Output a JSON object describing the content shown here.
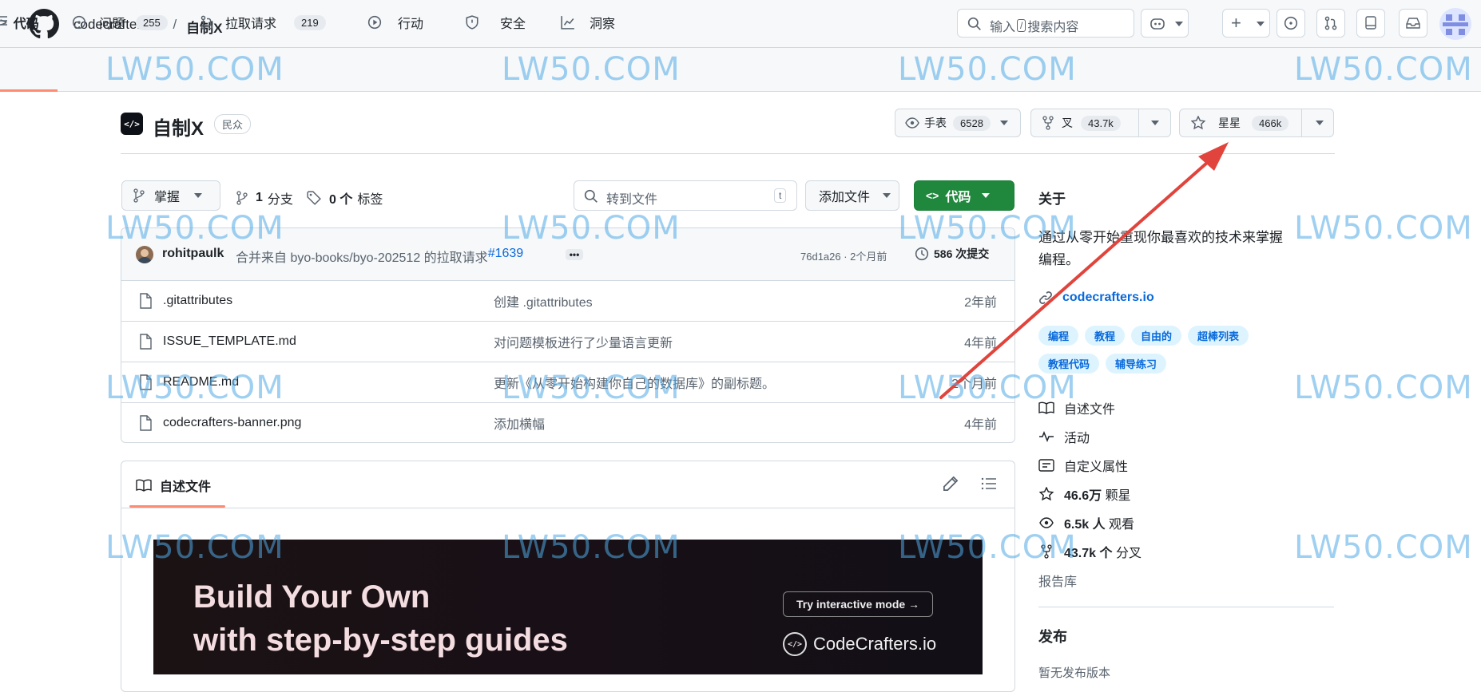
{
  "header": {
    "org": "codecrafters-io",
    "separator": "/",
    "repo": "自制X",
    "search_placeholder": "输入",
    "search_key": "/",
    "search_suffix": "搜索内容"
  },
  "tabs": [
    {
      "label": "代码"
    },
    {
      "label": "问题",
      "count": "255"
    },
    {
      "label": "拉取请求",
      "count": "219"
    },
    {
      "label": "行动"
    },
    {
      "label": "安全"
    },
    {
      "label": "洞察"
    }
  ],
  "repo_head": {
    "name": "自制X",
    "visibility": "民众",
    "watch_label": "手表",
    "watch_count": "6528",
    "fork_label": "叉",
    "fork_count": "43.7k",
    "star_label": "星星",
    "star_count": "466k"
  },
  "toolbar": {
    "branch": "掌握",
    "branches_num": "1",
    "branches_label": "分支",
    "tags_num": "0 个",
    "tags_label": "标签",
    "goto_file": "转到文件",
    "goto_key": "t",
    "add_file": "添加文件",
    "code": "代码"
  },
  "commit": {
    "author": "rohitpaulk",
    "message": "合并来自 byo-books/byo-202512 的拉取请求",
    "pr": "#1639",
    "hash": "76d1a26 · 2个月前",
    "count": "586 次提交"
  },
  "files": [
    {
      "name": ".gitattributes",
      "message": "创建 .gitattributes",
      "time": "2年前"
    },
    {
      "name": "ISSUE_TEMPLATE.md",
      "message": "对问题模板进行了少量语言更新",
      "time": "4年前"
    },
    {
      "name": "README.md",
      "message": "更新《从零开始构建你自己的数据库》的副标题。",
      "time": "2个月前"
    },
    {
      "name": "codecrafters-banner.png",
      "message": "添加横幅",
      "time": "4年前"
    }
  ],
  "readme": {
    "tab": "自述文件",
    "banner_line1": "Build Your Own",
    "banner_line2": "with step-by-step guides",
    "banner_button": "Try interactive mode →",
    "banner_brand": "CodeCrafters.io"
  },
  "about": {
    "title": "关于",
    "description_line1": "通过从零开始重现你最喜欢的技术来掌握",
    "description_line2": "编程。",
    "link": "codecrafters.io",
    "topics": [
      "编程",
      "教程",
      "自由的",
      "超棒列表",
      "教程代码",
      "辅导练习"
    ],
    "readme": "自述文件",
    "activity": "活动",
    "custom_props": "自定义属性",
    "stars_num": "46.6万",
    "stars_label": "颗星",
    "watchers_num": "6.5k 人",
    "watchers_label": "观看",
    "forks_num": "43.7k 个",
    "forks_label": "分叉",
    "report": "报告库"
  },
  "releases": {
    "title": "发布",
    "none": "暂无发布版本"
  },
  "watermark": "LW50.COM",
  "colors": {
    "accent": "#0969da",
    "green": "#1f883d",
    "arrow": "#e0443c",
    "tab_underline": "#fd8c73"
  }
}
